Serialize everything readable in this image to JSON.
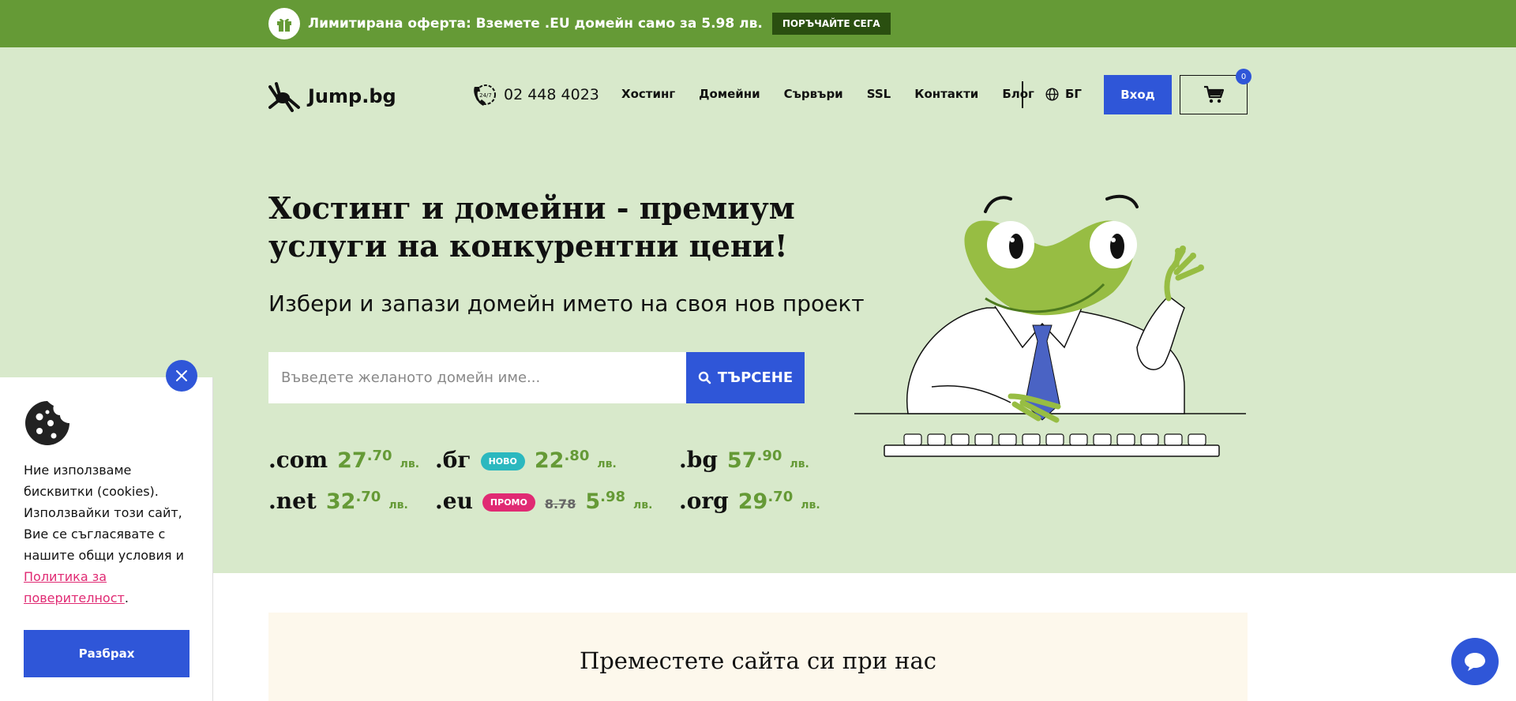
{
  "promo": {
    "text": "Лимитирана оферта: Вземете .EU домейн само за 5.98 лв.",
    "button": "ПОРЪЧАЙТЕ СЕГА"
  },
  "header": {
    "logo_text": "Jump.bg",
    "phone_badge": "24/7",
    "phone": "02 448 4023",
    "nav": [
      "Хостинг",
      "Домейни",
      "Сървъри",
      "SSL",
      "Контакти",
      "Блог"
    ],
    "language": "БГ",
    "login": "Вход",
    "cart_count": "0"
  },
  "hero": {
    "headline": "Хостинг и домейни - премиум услуги на конкурентни цени!",
    "subheadline": "Избери и запази домейн името на своя нов проект",
    "search_placeholder": "Въведете желаното домейн име...",
    "search_button": "ТЪРСЕНЕ"
  },
  "domains": [
    {
      "tld": ".com",
      "int": "27",
      "dec": ".70",
      "currency": "лв."
    },
    {
      "tld": ".бг",
      "badge": "НОВО",
      "int": "22",
      "dec": ".80",
      "currency": "лв."
    },
    {
      "tld": ".bg",
      "int": "57",
      "dec": ".90",
      "currency": "лв."
    },
    {
      "tld": ".net",
      "int": "32",
      "dec": ".70",
      "currency": "лв."
    },
    {
      "tld": ".eu",
      "badge": "ПРОМО",
      "old_price": "8.78",
      "int": "5",
      "dec": ".98",
      "currency": "лв."
    },
    {
      "tld": ".org",
      "int": "29",
      "dec": ".70",
      "currency": "лв."
    }
  ],
  "cookie": {
    "text": "Ние използваме бисквитки (cookies). Използвайки този сайт, Вие се съгласявате с нашите общи условия и",
    "link": "Политика за поверителност",
    "after_link": ".",
    "button": "Разбрах"
  },
  "migrate": {
    "title": "Преместете сайта си при нас"
  },
  "colors": {
    "green": "#659a36",
    "hero_bg": "#d8e9cb",
    "blue": "#2f56d8",
    "pink": "#e02a73",
    "teal": "#2bb8bf"
  }
}
